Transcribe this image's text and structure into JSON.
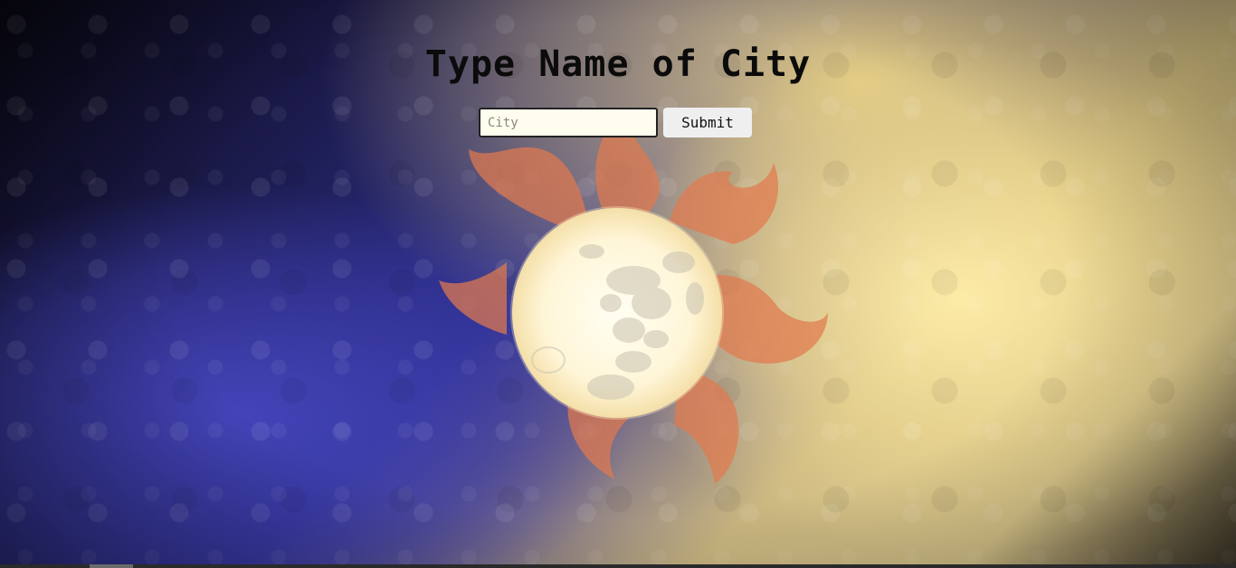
{
  "page": {
    "title": "Type Name of City"
  },
  "search": {
    "placeholder": "City",
    "value": "",
    "submit_label": "Submit"
  },
  "background": {
    "emblem": "sun-moon-emblem",
    "colors": {
      "sky_dark": "#07060f",
      "sky_blue": "#2f3192",
      "glow_yellow": "#ffeeaa",
      "flame_orange": "#e0764a",
      "moon_cream": "#fffbe6"
    }
  }
}
